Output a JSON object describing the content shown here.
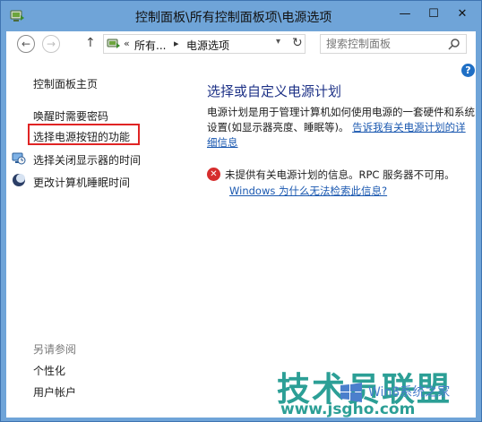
{
  "window": {
    "title": "控制面板\\所有控制面板项\\电源选项",
    "minimize_glyph": "—",
    "maximize_glyph": "☐",
    "close_glyph": "✕"
  },
  "nav": {
    "back_glyph": "←",
    "forward_glyph": "→",
    "up_glyph": "↑",
    "breadcrumb": [
      {
        "label": "所有..."
      },
      {
        "label": "电源选项"
      }
    ],
    "overflow_glyph": "«",
    "separator_glyph": "▸",
    "dropdown_glyph": "▾",
    "refresh_glyph": "↻",
    "search_placeholder": "搜索控制面板"
  },
  "help_glyph": "?",
  "sidebar": {
    "home_label": "控制面板主页",
    "items": [
      {
        "label": "唤醒时需要密码",
        "icon": ""
      },
      {
        "label": "选择电源按钮的功能",
        "icon": "",
        "highlighted": true
      },
      {
        "label": "选择关闭显示器的时间",
        "icon": "monitor-clock-icon"
      },
      {
        "label": "更改计算机睡眠时间",
        "icon": "moon-icon"
      }
    ],
    "see_also_title": "另请参阅",
    "see_also": [
      {
        "label": "个性化"
      },
      {
        "label": "用户帐户"
      }
    ]
  },
  "main": {
    "title": "选择或自定义电源计划",
    "desc_text": "电源计划是用于管理计算机如何使用电源的一套硬件和系统设置(如显示器亮度、睡眠等)。",
    "desc_link": "告诉我有关电源计划的详细信息",
    "error_text": "未提供有关电源计划的信息。RPC 服务器不可用。",
    "error_link": "Windows 为什么无法检索此信息?",
    "error_glyph": "✕"
  },
  "watermark": {
    "main": "技术员联盟",
    "url": "www.jsgho.com",
    "sub": "Win8系统之家"
  },
  "colors": {
    "title_bar": "#6fa4d8",
    "link": "#1a58b0",
    "heading": "#1e3287",
    "highlight_border": "#e02424",
    "error_red": "#d62d2d",
    "watermark_teal": "#2c9f96"
  }
}
